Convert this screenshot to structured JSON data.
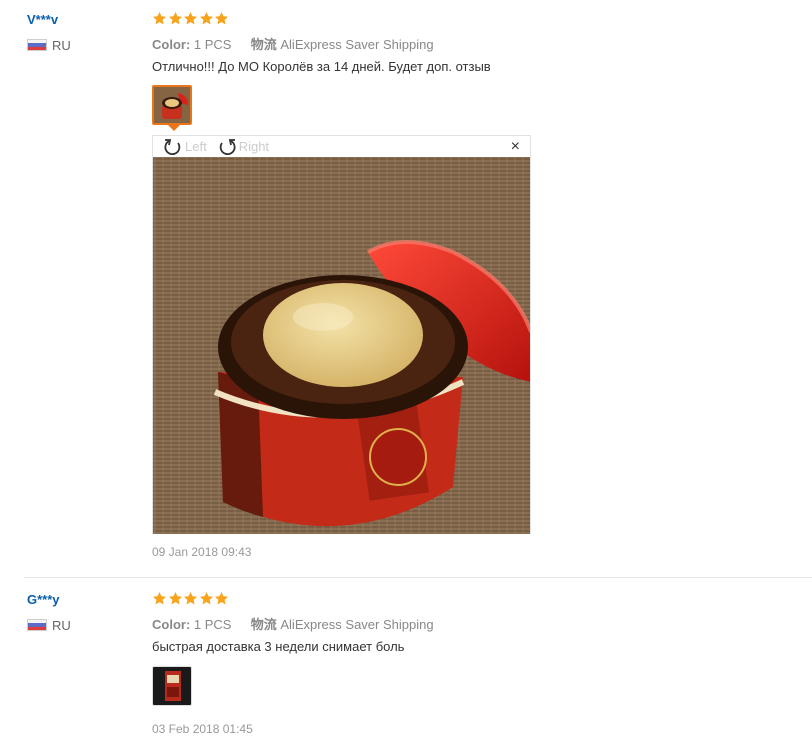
{
  "colors": {
    "star": "#f7a31c",
    "username": "#0a5fa8",
    "active_thumb_border": "#e8761b"
  },
  "reviews": [
    {
      "user": "V***v",
      "country": "RU",
      "rating": 5,
      "color_label": "Color:",
      "color_value": "1 PCS",
      "shipping_label": "物流",
      "shipping_value": "AliExpress Saver Shipping",
      "text": "Отлично!!! До МО Королёв за 14 дней. Будет доп. отзыв",
      "viewer": {
        "rotate_left": "Left",
        "rotate_right": "Right",
        "close": "×"
      },
      "date": "09 Jan 2018 09:43"
    },
    {
      "user": "G***y",
      "country": "RU",
      "rating": 5,
      "color_label": "Color:",
      "color_value": "1 PCS",
      "shipping_label": "物流",
      "shipping_value": "AliExpress Saver Shipping",
      "text": "быстрая доставка 3 недели снимает боль",
      "date": "03 Feb 2018 01:45"
    }
  ]
}
